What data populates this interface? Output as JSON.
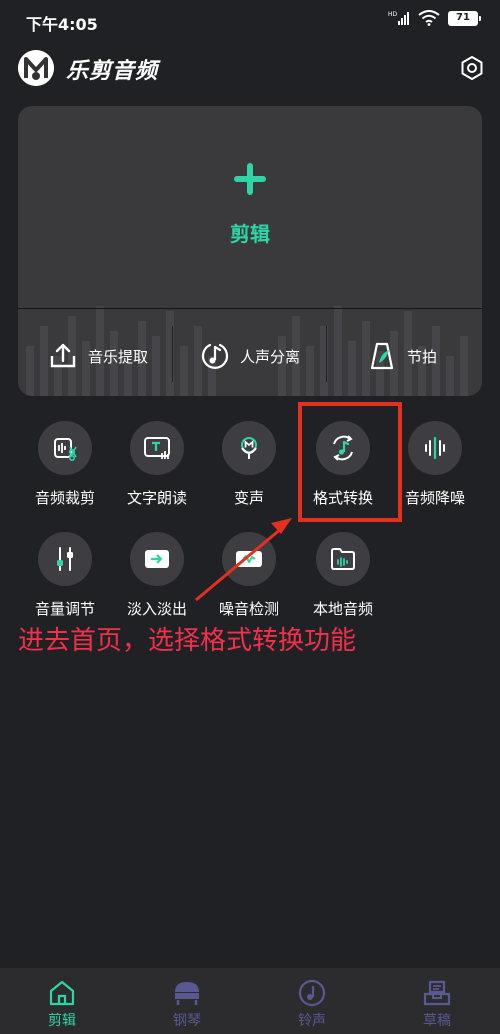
{
  "status_bar": {
    "time": "下午4:05",
    "battery": "71"
  },
  "header": {
    "title": "乐剪音频"
  },
  "main_card": {
    "primary_label": "剪辑",
    "tools": [
      {
        "label": "音乐提取",
        "icon": "upload-icon"
      },
      {
        "label": "人声分离",
        "icon": "music-note-icon"
      },
      {
        "label": "节拍",
        "icon": "metronome-icon"
      }
    ]
  },
  "grid": {
    "row1": [
      {
        "label": "音频裁剪",
        "icon": "audio-cut-icon"
      },
      {
        "label": "文字朗读",
        "icon": "text-read-icon"
      },
      {
        "label": "变声",
        "icon": "voice-change-icon"
      },
      {
        "label": "格式转换",
        "icon": "format-convert-icon"
      },
      {
        "label": "音频降噪",
        "icon": "noise-reduce-icon"
      }
    ],
    "row2": [
      {
        "label": "音量调节",
        "icon": "volume-adjust-icon"
      },
      {
        "label": "淡入淡出",
        "icon": "fade-icon"
      },
      {
        "label": "噪音检测",
        "icon": "noise-detect-icon"
      },
      {
        "label": "本地音频",
        "icon": "local-audio-icon"
      }
    ]
  },
  "annotation": "进去首页，选择格式转换功能",
  "bottom_nav": [
    {
      "label": "剪辑",
      "icon": "home-icon",
      "active": true
    },
    {
      "label": "钢琴",
      "icon": "piano-icon",
      "active": false
    },
    {
      "label": "铃声",
      "icon": "ringtone-icon",
      "active": false
    },
    {
      "label": "草稿",
      "icon": "draft-icon",
      "active": false
    }
  ],
  "colors": {
    "accent": "#2ed5a8",
    "background": "#202124",
    "card": "#3a3a3d",
    "annotation": "#f2304a",
    "inactive_nav": "#5a5890"
  }
}
